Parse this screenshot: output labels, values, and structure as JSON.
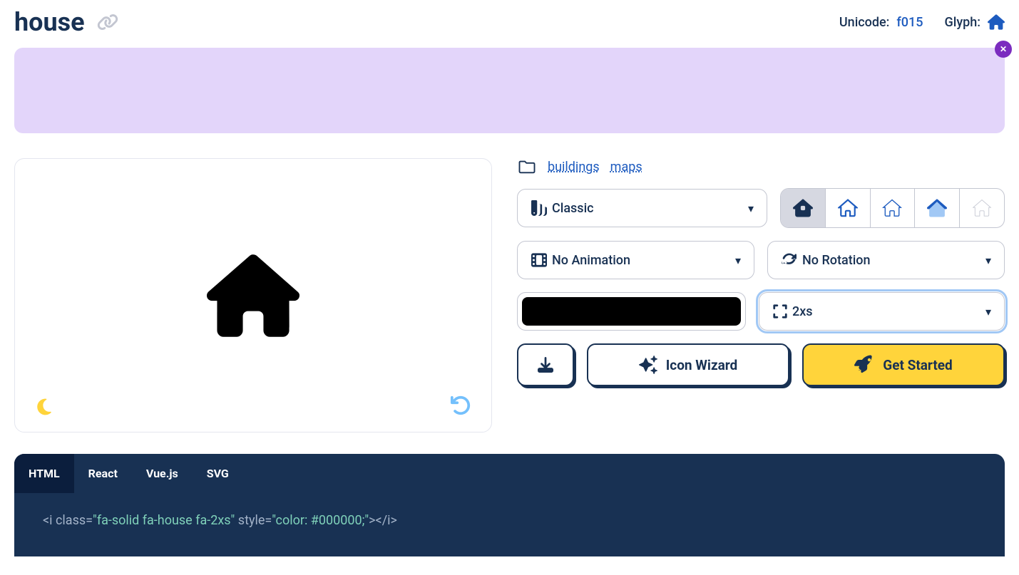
{
  "header": {
    "title": "house",
    "unicode_label": "Unicode:",
    "unicode_value": "f015",
    "glyph_label": "Glyph:"
  },
  "categories": {
    "items": [
      "buildings",
      "maps"
    ]
  },
  "controls": {
    "family": "Classic",
    "animation": "No Animation",
    "rotation": "No Rotation",
    "size": "2xs",
    "color": "#000000"
  },
  "buttons": {
    "wizard": "Icon Wizard",
    "get_started": "Get Started"
  },
  "code": {
    "tabs": [
      "HTML",
      "React",
      "Vue.js",
      "SVG"
    ],
    "active_tab": "HTML",
    "snippet_prefix": "<i class=",
    "snippet_class": "\"fa-solid fa-house fa-2xs\"",
    "snippet_mid": " style=",
    "snippet_style": "\"color: #000000;\"",
    "snippet_suffix": "></i>"
  }
}
